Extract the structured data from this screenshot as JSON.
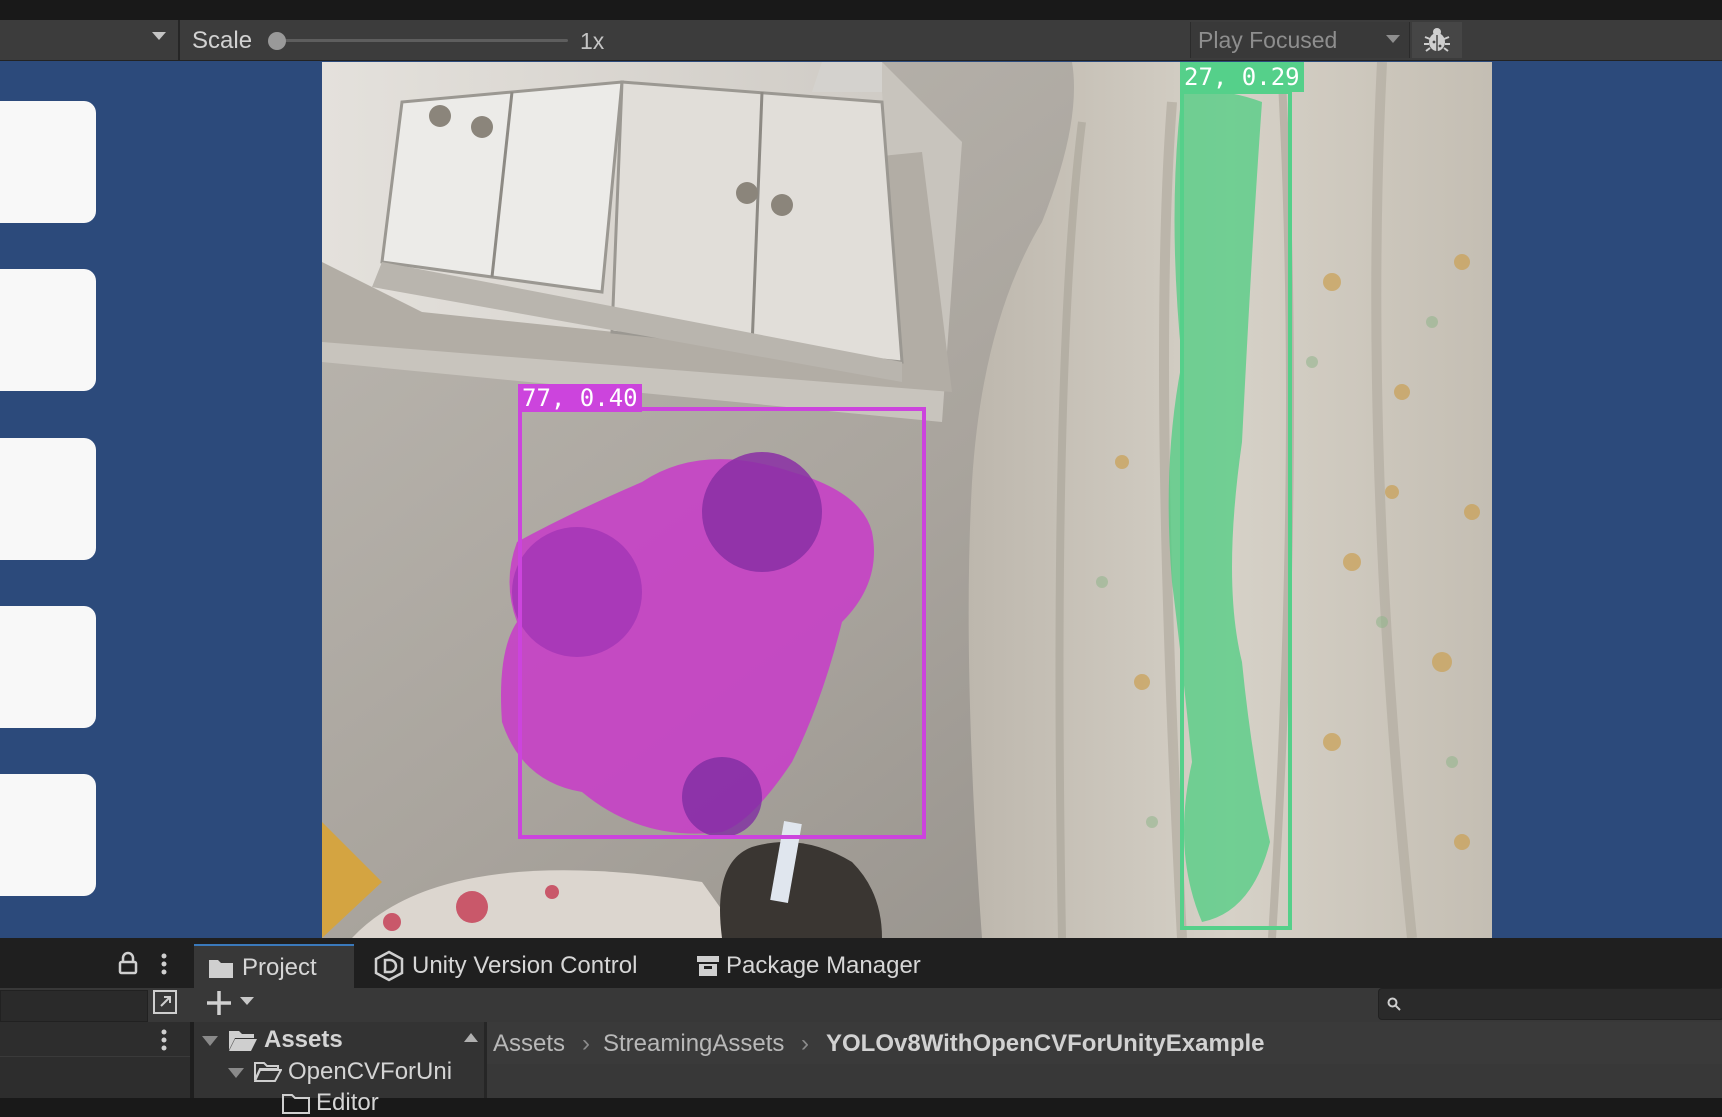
{
  "toolbar": {
    "scale_label": "Scale",
    "scale_value": "1x",
    "scale_level": 0.0,
    "play_mode": "Play Focused",
    "bug_icon": "bug-icon"
  },
  "game_view": {
    "background_color": "#2c4a7b",
    "detections": [
      {
        "label": "77, 0.40",
        "color": "#cc44dd"
      },
      {
        "label": "27, 0.29",
        "color": "#55d08a"
      }
    ]
  },
  "bottom_panel": {
    "tabs": [
      {
        "label": "Project",
        "icon": "folder-icon",
        "active": true
      },
      {
        "label": "Unity Version Control",
        "icon": "version-control-icon",
        "active": false
      },
      {
        "label": "Package Manager",
        "icon": "package-icon",
        "active": false
      }
    ],
    "tree": [
      {
        "label": "Assets",
        "icon": "folder-open-icon"
      },
      {
        "label": "OpenCVForUni",
        "icon": "folder-open-icon"
      },
      {
        "label": "Editor",
        "icon": "folder-icon"
      }
    ],
    "breadcrumbs": [
      "Assets",
      "StreamingAssets",
      "YOLOv8WithOpenCVForUnityExample"
    ]
  }
}
